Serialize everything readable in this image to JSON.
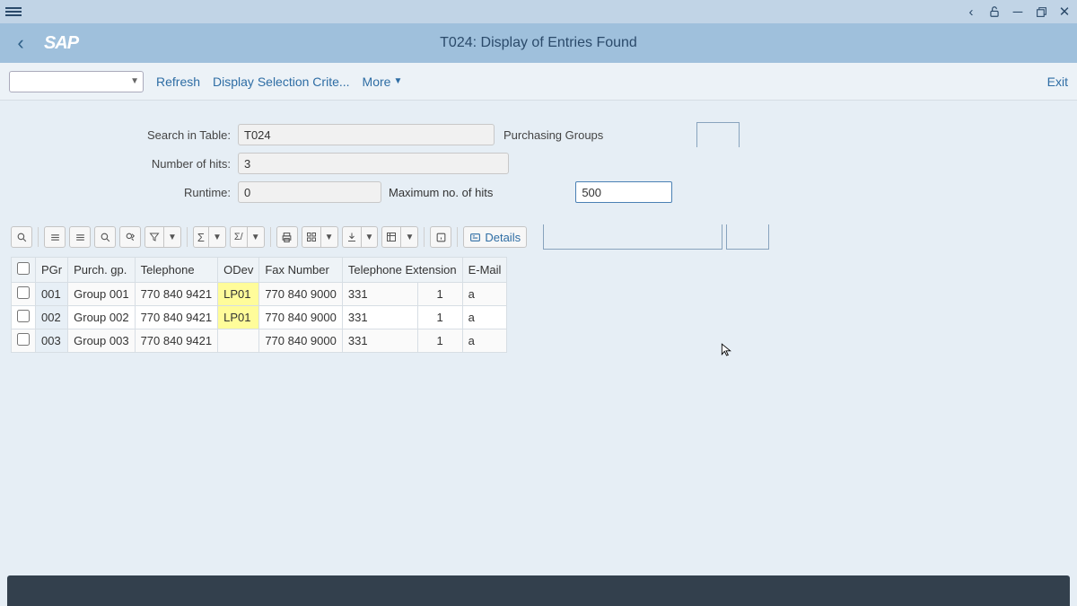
{
  "window": {
    "title": "T024: Display of Entries Found"
  },
  "toolbar": {
    "refresh": "Refresh",
    "display_selection": "Display Selection Crite...",
    "more": "More",
    "exit": "Exit"
  },
  "form": {
    "search_in_table_label": "Search in Table:",
    "search_in_table_value": "T024",
    "table_desc": "Purchasing Groups",
    "number_of_hits_label": "Number of hits:",
    "number_of_hits_value": "3",
    "runtime_label": "Runtime:",
    "runtime_value": "0",
    "max_hits_label": "Maximum no. of hits",
    "max_hits_value": "500"
  },
  "alv": {
    "details": "Details"
  },
  "table": {
    "headers": {
      "pgr": "PGr",
      "purchgp": "Purch. gp.",
      "telephone": "Telephone",
      "odev": "ODev",
      "fax": "Fax Number",
      "telext": "Telephone Extension",
      "email": "E-Mail"
    },
    "rows": [
      {
        "pgr": "001",
        "purchgp": "Group 001",
        "telephone": "770 840 9421",
        "odev": "LP01",
        "fax": "770 840 9000",
        "telext": "331",
        "ext2": "1",
        "email": "a",
        "hl": true
      },
      {
        "pgr": "002",
        "purchgp": "Group 002",
        "telephone": "770 840 9421",
        "odev": "LP01",
        "fax": "770 840 9000",
        "telext": "331",
        "ext2": "1",
        "email": "a",
        "hl": true
      },
      {
        "pgr": "003",
        "purchgp": "Group 003",
        "telephone": "770 840 9421",
        "odev": "",
        "fax": "770 840 9000",
        "telext": "331",
        "ext2": "1",
        "email": "a",
        "hl": false
      }
    ]
  }
}
